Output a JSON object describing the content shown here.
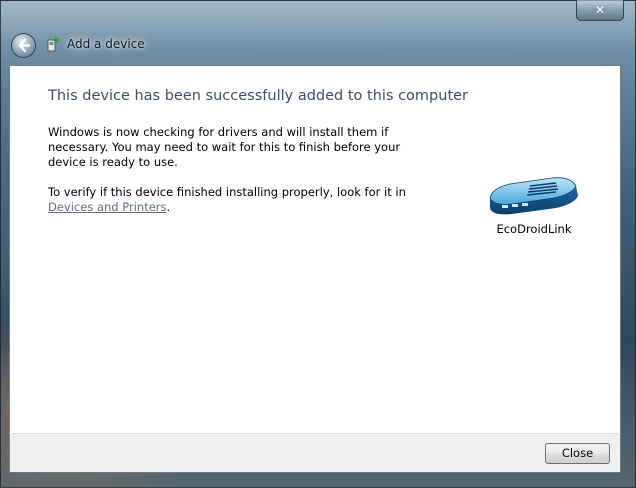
{
  "window": {
    "title": "Add a device",
    "close_glyph": "✕"
  },
  "content": {
    "headline": "This device has been successfully added to this computer",
    "paragraph1": "Windows is now checking for drivers and will install them if necessary. You may need to wait for this to finish before your device is ready to use.",
    "paragraph2_prefix": "To verify if this device finished installing properly, look for it in",
    "paragraph2_link": "Devices and Printers",
    "paragraph2_suffix": "."
  },
  "device": {
    "name": "EcoDroidLink",
    "icon": "router-device-icon"
  },
  "footer": {
    "close_label": "Close"
  },
  "colors": {
    "headline": "#3d4f6e",
    "link": "#5f6f7f",
    "content_bg": "#ffffff",
    "footer_bg": "#f0f0f0"
  }
}
